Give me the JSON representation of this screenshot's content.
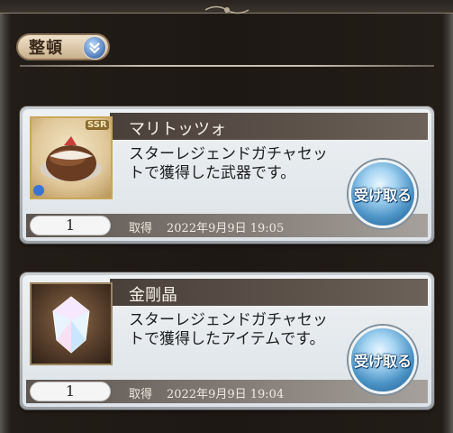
{
  "header": {
    "sort_label": "整頓",
    "sort_icon": "double-chevron-down-icon"
  },
  "items": [
    {
      "name": "マリトッツォ",
      "description": "スターレジェンドガチャセットで獲得した武器です。",
      "rarity": "SSR",
      "quantity": "1",
      "acquired_label": "取得",
      "acquired_date": "2022年9月9日 19:05",
      "receive_label": "受け取る",
      "icon": "maritozzo-weapon-icon"
    },
    {
      "name": "金剛晶",
      "description": "スターレジェンドガチャセットで獲得したアイテムです。",
      "quantity": "1",
      "acquired_label": "取得",
      "acquired_date": "2022年9月9日 19:04",
      "receive_label": "受け取る",
      "icon": "crystal-item-icon"
    }
  ],
  "colors": {
    "accent_blue": "#4c93c6",
    "panel": "#dde3e8",
    "frame_dark": "#1e1814"
  }
}
